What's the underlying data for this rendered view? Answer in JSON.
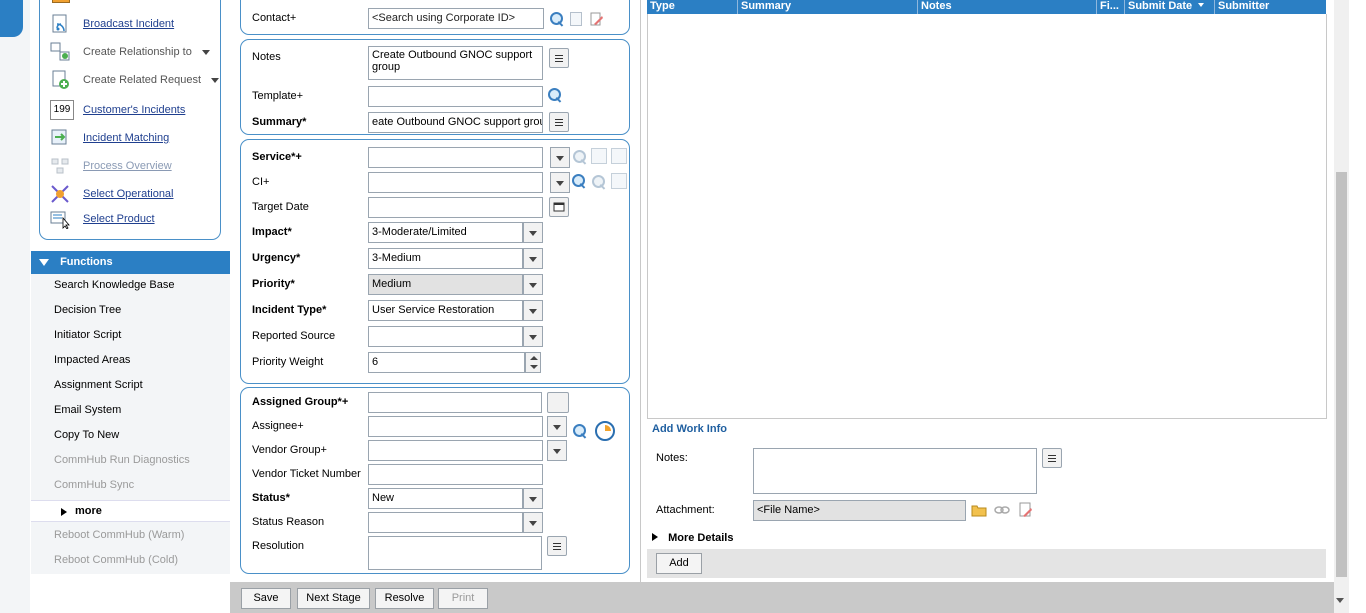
{
  "quick_links": {
    "items": [
      {
        "label": "Broadcast Incident",
        "icon": "broadcast-icon",
        "style": "link"
      },
      {
        "label": "Create Relationship to",
        "icon": "relationship-icon",
        "style": "menu"
      },
      {
        "label": "Create Related Request",
        "icon": "related-request-icon",
        "style": "menu"
      },
      {
        "label": "Customer's Incidents",
        "icon": "customer-incidents-icon",
        "style": "link",
        "badge": "199"
      },
      {
        "label": "Incident Matching",
        "icon": "incident-matching-icon",
        "style": "link"
      },
      {
        "label": "Process Overview",
        "icon": "process-overview-icon",
        "style": "disabled"
      },
      {
        "label": "Select Operational",
        "icon": "select-operational-icon",
        "style": "link"
      },
      {
        "label": "Select Product",
        "icon": "select-product-icon",
        "style": "link"
      }
    ]
  },
  "functions": {
    "header": "Functions",
    "items": [
      {
        "label": "Search Knowledge Base",
        "enabled": true
      },
      {
        "label": "Decision Tree",
        "enabled": true
      },
      {
        "label": "Initiator Script",
        "enabled": true
      },
      {
        "label": "Impacted Areas",
        "enabled": true
      },
      {
        "label": "Assignment Script",
        "enabled": true
      },
      {
        "label": "Email System",
        "enabled": true
      },
      {
        "label": "Copy To New",
        "enabled": true
      },
      {
        "label": "CommHub Run Diagnostics",
        "enabled": false
      },
      {
        "label": "CommHub Sync",
        "enabled": false
      }
    ],
    "more_label": "more",
    "after_more": [
      {
        "label": "Reboot CommHub (Warm)",
        "enabled": false
      },
      {
        "label": "Reboot CommHub (Cold)",
        "enabled": false
      }
    ]
  },
  "contact": {
    "label": "Contact+",
    "placeholder": "<Search using Corporate ID>"
  },
  "notes": {
    "label": "Notes",
    "value": "Create Outbound GNOC support group"
  },
  "template": {
    "label": "Template+",
    "value": ""
  },
  "summary": {
    "label": "Summary*",
    "value": "eate Outbound GNOC support group"
  },
  "classification": {
    "service": {
      "label": "Service*+",
      "value": ""
    },
    "ci": {
      "label": "CI+",
      "value": ""
    },
    "target_date": {
      "label": "Target Date",
      "value": ""
    },
    "impact": {
      "label": "Impact*",
      "value": "3-Moderate/Limited"
    },
    "urgency": {
      "label": "Urgency*",
      "value": "3-Medium"
    },
    "priority": {
      "label": "Priority*",
      "value": "Medium"
    },
    "incident_type": {
      "label": "Incident Type*",
      "value": "User Service Restoration"
    },
    "reported_source": {
      "label": "Reported Source",
      "value": ""
    },
    "priority_weight": {
      "label": "Priority Weight",
      "value": "6"
    }
  },
  "assignment": {
    "assigned_group": {
      "label": "Assigned Group*+",
      "value": ""
    },
    "assignee": {
      "label": "Assignee+",
      "value": ""
    },
    "vendor_group": {
      "label": "Vendor Group+",
      "value": ""
    },
    "vendor_ticket": {
      "label": "Vendor Ticket Number",
      "value": ""
    },
    "status": {
      "label": "Status*",
      "value": "New"
    },
    "status_reason": {
      "label": "Status Reason",
      "value": ""
    },
    "resolution": {
      "label": "Resolution",
      "value": ""
    }
  },
  "work_info": {
    "columns": [
      "Type",
      "Summary",
      "Notes",
      "Fi...",
      "Submit Date",
      "Submitter"
    ],
    "add_work_info_label": "Add Work Info",
    "notes_label": "Notes:",
    "attachment_label": "Attachment:",
    "attachment_placeholder": "<File Name>",
    "more_details_label": "More Details",
    "add_button": "Add"
  },
  "toolbar": {
    "save": "Save",
    "next_stage": "Next Stage",
    "resolve": "Resolve",
    "print": "Print"
  },
  "colors": {
    "accent": "#2b7fc4",
    "link": "#1f3f8f",
    "panel_border": "#4a90c8"
  }
}
